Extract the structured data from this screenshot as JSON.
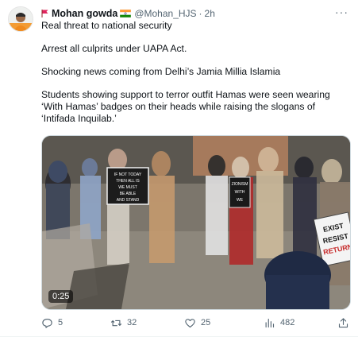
{
  "author": {
    "name": "Mohan gowda",
    "handle": "@Mohan_HJS",
    "separator": "·",
    "time": "2h"
  },
  "menu_icon": "more-horizontal-icon",
  "tweet_text": [
    "Real threat to national security",
    "Arrest all culprits under UAPA Act.",
    "Shocking news coming from Delhi’s Jamia Millia Islamia",
    "Students showing support to terror outfit Hamas were seen wearing ‘With Hamas’ badges on their heads while raising the slogans of ‘Intifada Inquilab.’"
  ],
  "video": {
    "duration": "0:25",
    "signs": {
      "sign_left": [
        "IF NOT TODAY",
        "THEN ALL IS",
        "WE MUST",
        "BE ABLE",
        "AND STAND"
      ],
      "sign_center": [
        "ZIONISM",
        "WITH",
        "WE"
      ],
      "sign_right": [
        "EXIST",
        "RESIST",
        "RETURN"
      ]
    }
  },
  "actions": {
    "reply_icon": "reply-icon",
    "replies": "5",
    "retweet_icon": "retweet-icon",
    "retweets": "32",
    "like_icon": "heart-icon",
    "likes": "25",
    "views_icon": "bar-chart-icon",
    "views": "482",
    "share_icon": "share-icon"
  },
  "colors": {
    "text_primary": "#0f1419",
    "text_secondary": "#536471",
    "border": "#cfd9de",
    "flag_red": "#e0245e",
    "saffron": "#ff9933",
    "india_green": "#138808"
  }
}
